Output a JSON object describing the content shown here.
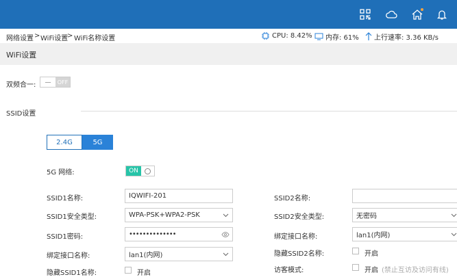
{
  "breadcrumb": {
    "home": "网络设置",
    "sep": ">",
    "level1": "WiFi设置",
    "level2": "WiFi名称设置"
  },
  "stats": {
    "cpu": "CPU: 8.42%",
    "memory": "内存: 61%",
    "upload": "上行速率: 3.36 KB/s"
  },
  "section": {
    "title": "WiFi设置"
  },
  "dual_band": {
    "label": "双频合一:",
    "knob": "一",
    "state": "OFF"
  },
  "ssid": {
    "heading": "SSID设置",
    "tabs": [
      "2.4G",
      "5G"
    ],
    "active_tab": "5G"
  },
  "network_5g": {
    "label": "5G 网络:",
    "state": "ON"
  },
  "ssid1": {
    "name_label": "SSID1名称:",
    "name_value": "IQWIFI-201",
    "security_label": "SSID1安全类型:",
    "security_value": "WPA-PSK+WPA2-PSK",
    "password_label": "SSID1密码:",
    "password_value": "••••••••••••••",
    "interface_label": "绑定接口名称:",
    "interface_value": "lan1(内网)",
    "hide_label": "隐藏SSID1名称:",
    "hide_option": "开启"
  },
  "ssid2": {
    "name_label": "SSID2名称:",
    "name_value": "",
    "security_label": "SSID2安全类型:",
    "security_value": "无密码",
    "interface_label": "绑定接口名称:",
    "interface_value": "lan1(内网)",
    "hide_label": "隐藏SSID2名称:",
    "hide_option": "开启",
    "guest_label": "访客模式:",
    "guest_option": "开启",
    "guest_hint": "(禁止互访及访问有线)"
  },
  "colors": {
    "topbar": "#1f6fb8",
    "accent": "#2a82d8",
    "on": "#27c4a8"
  },
  "icons": [
    "apps-icon",
    "cloud-icon",
    "home-icon",
    "bell-icon",
    "cpu-icon",
    "monitor-icon",
    "upload-arrow-icon",
    "chevron-down-icon",
    "eye-icon"
  ]
}
